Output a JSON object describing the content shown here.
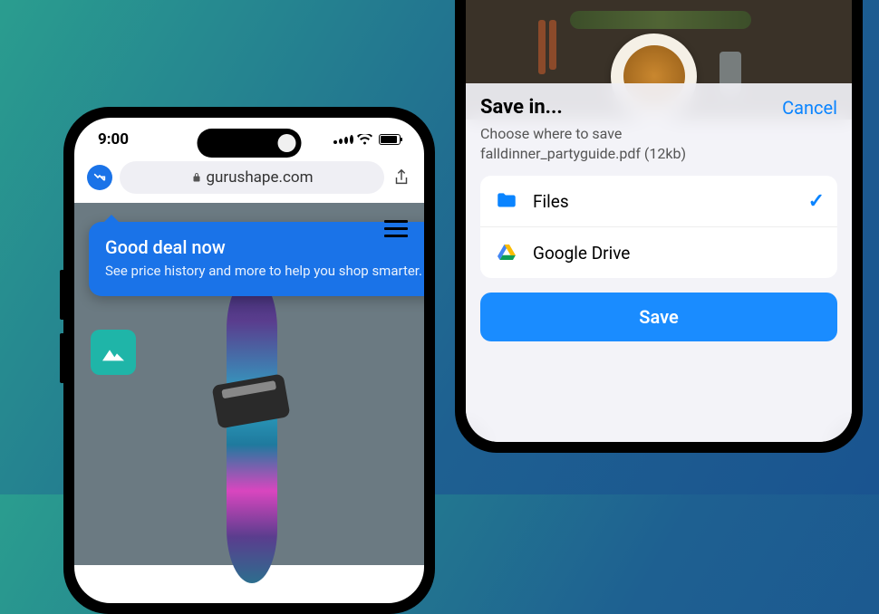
{
  "left_phone": {
    "status": {
      "time": "9:00"
    },
    "address_bar": {
      "url": "gurushape.com"
    },
    "tooltip": {
      "title": "Good deal now",
      "body": "See price history and more to help you shop smarter."
    }
  },
  "right_phone": {
    "sheet": {
      "title": "Save in...",
      "cancel": "Cancel",
      "subtitle_line1": "Choose where to save",
      "subtitle_line2": "falldinner_partyguide.pdf (12kb)",
      "options": [
        {
          "label": "Files",
          "selected": true
        },
        {
          "label": "Google Drive",
          "selected": false
        }
      ],
      "save_button": "Save"
    }
  }
}
